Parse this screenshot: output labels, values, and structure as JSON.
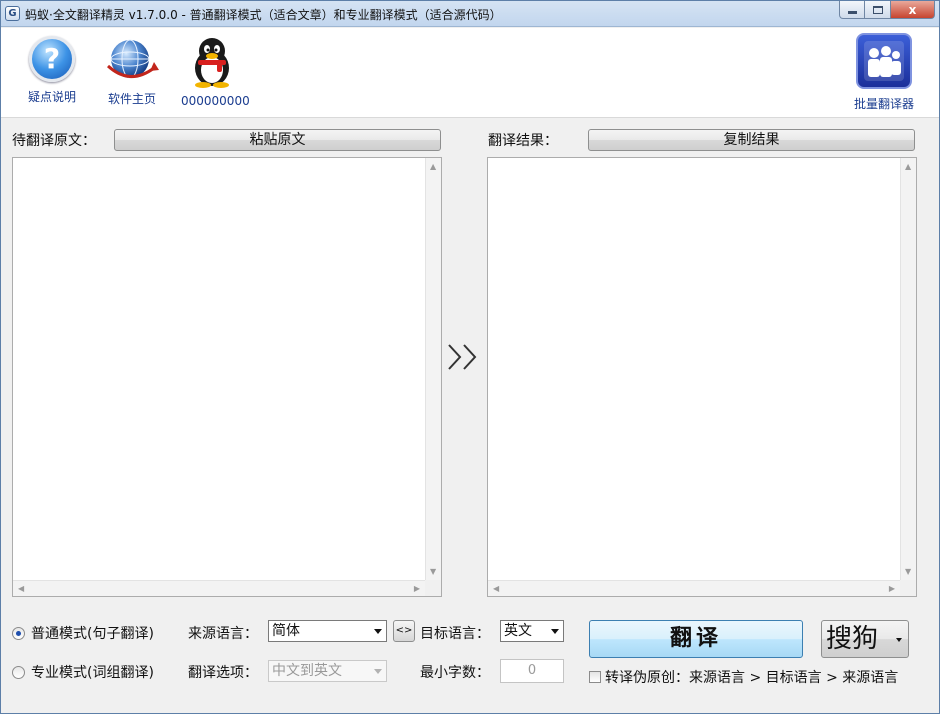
{
  "window": {
    "title": "蚂蚁·全文翻译精灵 v1.7.0.0 - 普通翻译模式（适合文章）和专业翻译模式（适合源代码）",
    "close_glyph": "x"
  },
  "toolbar": {
    "help_label": "疑点说明",
    "home_label": "软件主页",
    "qq_label": "000000000",
    "batch_label": "批量翻译器"
  },
  "source": {
    "label": "待翻译原文：",
    "paste_button": "粘贴原文",
    "text": ""
  },
  "result": {
    "label": "翻译结果：",
    "copy_button": "复制结果",
    "text": ""
  },
  "arrow_glyph": "»",
  "modes": {
    "normal": "普通模式(句子翻译)",
    "professional": "专业模式(词组翻译)",
    "selected": "normal"
  },
  "options": {
    "source_lang_label": "来源语言：",
    "source_lang_value": "简体",
    "swap_glyph": "<>",
    "target_lang_label": "目标语言：",
    "target_lang_value": "英文",
    "translate_option_label": "翻译选项：",
    "translate_option_value": "中文到英文",
    "min_chars_label": "最小字数：",
    "min_chars_value": "0"
  },
  "actions": {
    "translate_button": "翻译",
    "engine_button": "搜狗",
    "pseudo_original_label": "转译伪原创：来源语言 > 目标语言 > 来源语言"
  },
  "colors": {
    "link_blue": "#1a3c8f",
    "translate_button_bg": "#bee6fd",
    "title_bar": "#c9daf0"
  }
}
